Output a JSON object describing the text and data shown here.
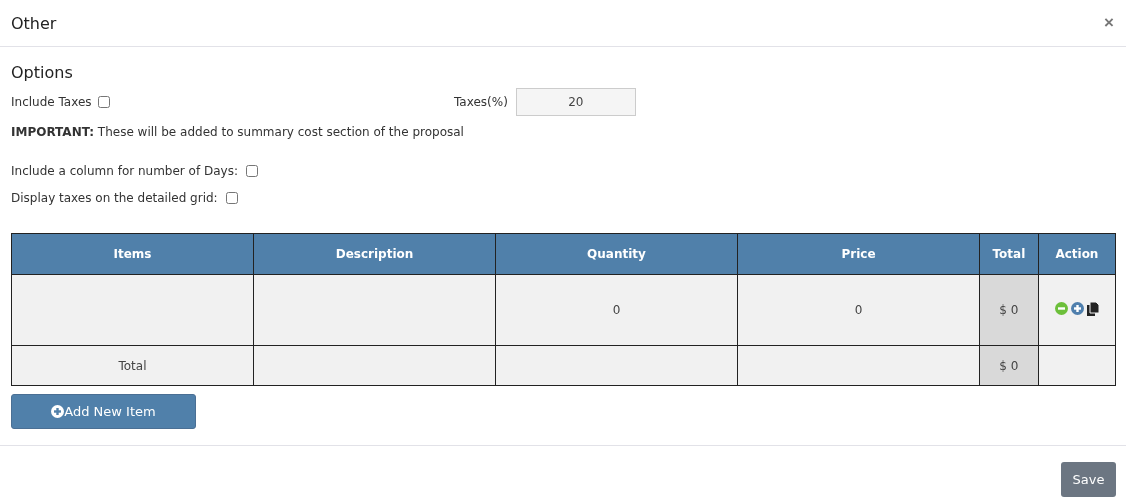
{
  "window": {
    "title": "Other",
    "close": "×"
  },
  "options": {
    "heading": "Options",
    "include_taxes": {
      "label": "Include Taxes",
      "checked": false
    },
    "taxes": {
      "label": "Taxes(%)",
      "value": "20"
    },
    "note": "**IMPORTANT:** These will be added to summary cost section of the proposal",
    "checks": [
      {
        "label": "Include a column for number of Days:",
        "checked": false
      },
      {
        "label": "Display taxes on the detailed grid:",
        "checked": false
      }
    ]
  },
  "table": {
    "columns": [
      "Items",
      "Description",
      "Quantity",
      "Price",
      "Total",
      "Action"
    ],
    "rows": [
      {
        "kind": "item",
        "quantity": "0",
        "price": "0",
        "total": "$ 0"
      },
      {
        "kind": "total",
        "label": "Total",
        "total": "$ 0"
      }
    ]
  },
  "add_button": "Add New Item",
  "save_button": "Save"
}
